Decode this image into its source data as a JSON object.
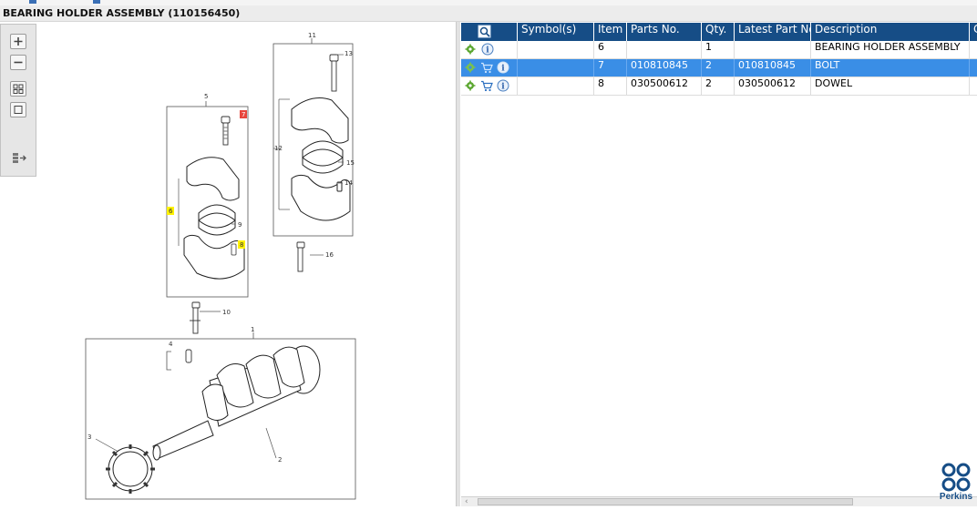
{
  "window": {
    "title": "BEARING HOLDER ASSEMBLY (110156450)"
  },
  "toolbox": {
    "items": [
      {
        "name": "zoom-in-icon"
      },
      {
        "name": "zoom-out-icon"
      },
      {
        "name": "fit-all-icon"
      },
      {
        "name": "fit-window-icon"
      },
      {
        "name": "toggle-panel-icon"
      }
    ]
  },
  "diagram": {
    "callouts": {
      "c1": "1",
      "c2": "2",
      "c3": "3",
      "c4": "4",
      "c5": "5",
      "c6": "6",
      "c8": "8",
      "c9": "9",
      "c10": "10",
      "c11": "11",
      "c12": "12",
      "c13": "13",
      "c14": "14",
      "c15": "15",
      "c16": "16",
      "c7": "7"
    },
    "highlight_color": "#fff200",
    "selected_color": "#e8453c"
  },
  "parts_table": {
    "columns": [
      "",
      "Symbol(s)",
      "Item",
      "Parts No.",
      "Qty.",
      "Latest Part No.",
      "Description",
      "C"
    ],
    "rows": [
      {
        "item": "6",
        "parts_no": "",
        "qty": "1",
        "latest_part_no": "",
        "description": "BEARING HOLDER ASSEMBLY",
        "icons": [
          "gear-icon",
          "info-icon"
        ],
        "selected": false
      },
      {
        "item": "7",
        "parts_no": "010810845",
        "qty": "2",
        "latest_part_no": "010810845",
        "description": "BOLT",
        "icons": [
          "gear-icon",
          "cart-icon",
          "info-icon"
        ],
        "selected": true
      },
      {
        "item": "8",
        "parts_no": "030500612",
        "qty": "2",
        "latest_part_no": "030500612",
        "description": "DOWEL",
        "icons": [
          "gear-icon",
          "cart-icon",
          "info-icon"
        ],
        "selected": false
      }
    ],
    "header_color": "#164d86",
    "selected_row_color": "#3a8ee6"
  },
  "brand": {
    "logo_text": "Perkins"
  }
}
